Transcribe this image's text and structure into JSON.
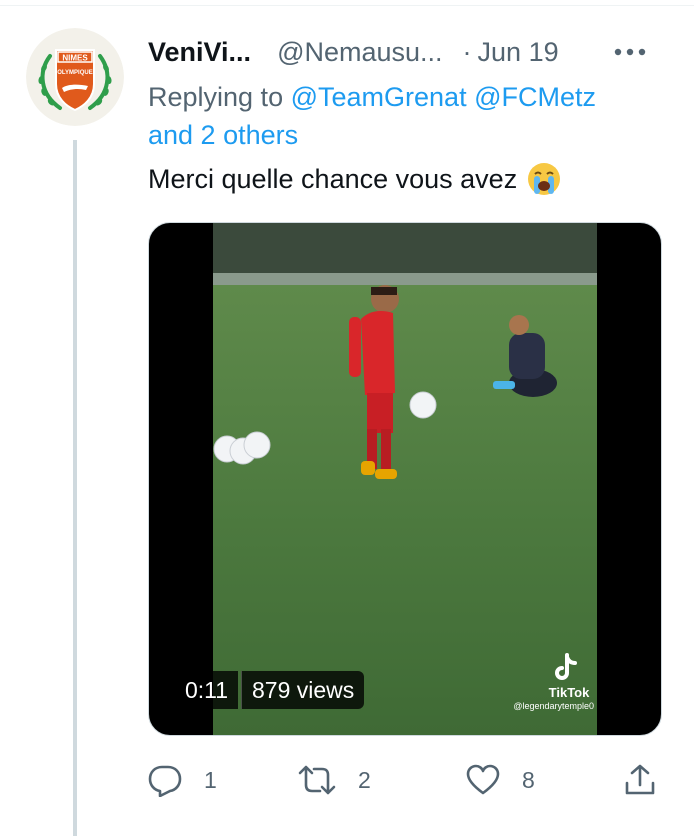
{
  "tweet": {
    "display_name": "VeniVi...",
    "handle": "@Nemausu...",
    "separator": "·",
    "date": "Jun 19",
    "more_icon": "more-horizontal-icon",
    "replying_prefix": "Replying to ",
    "reply_mention_1": "@TeamGrenat",
    "reply_mention_2": "@FCMetz",
    "reply_others": "and 2 others",
    "text": "Merci quelle chance vous avez",
    "emoji": "loudly-crying-face-emoji"
  },
  "avatar": {
    "logo_top": "NIMES",
    "logo_bottom": "OLYMPIQUE",
    "primary_color": "#e05a1c",
    "accent_color": "#2f9e4b"
  },
  "media": {
    "duration": "0:11",
    "views": "879 views",
    "watermark_brand": "TikTok",
    "watermark_user": "@legendarytemple0"
  },
  "actions": {
    "reply_count": "1",
    "retweet_count": "2",
    "like_count": "8",
    "reply_icon": "reply-icon",
    "retweet_icon": "retweet-icon",
    "like_icon": "heart-icon",
    "share_icon": "share-icon"
  },
  "colors": {
    "link": "#1d9bf0",
    "secondary_text": "#536471",
    "thread_line": "#cfd9de"
  }
}
